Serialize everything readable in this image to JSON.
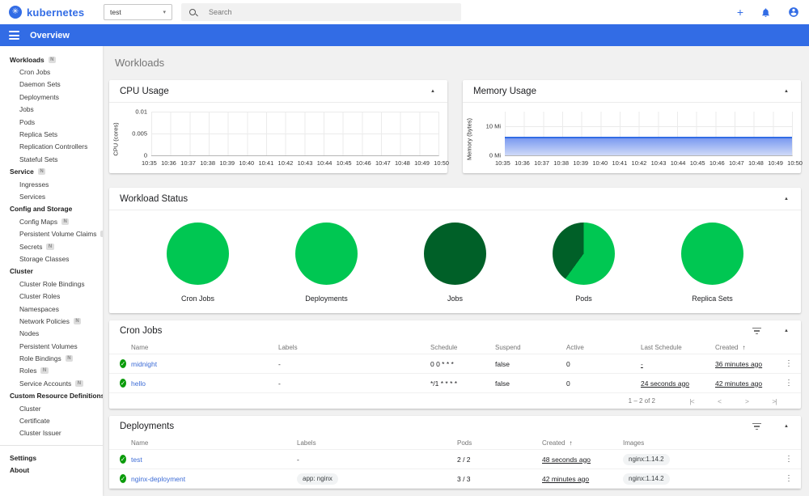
{
  "colors": {
    "brand_blue": "#326ce5",
    "success_green": "#00c752",
    "dark_green": "#006028",
    "check_green": "#0a9b0a",
    "link_blue": "#3d6cd6"
  },
  "icons": {
    "logo_glyph": "✳",
    "dropdown_caret": "▾",
    "plus": "+",
    "collapse_caret": "▲",
    "kebab": "⋮",
    "check": "✓",
    "sort_asc": "↑",
    "pager_first": "|<",
    "pager_prev": "<",
    "pager_next": ">",
    "pager_last": ">|"
  },
  "header": {
    "logo_text": "kubernetes",
    "namespace_selector": {
      "value": "test"
    },
    "search": {
      "placeholder": "Search"
    }
  },
  "appbar": {
    "title": "Overview"
  },
  "sidebar": {
    "items": [
      {
        "kind": "header",
        "label": "Workloads",
        "badge": "N"
      },
      {
        "kind": "child",
        "label": "Cron Jobs"
      },
      {
        "kind": "child",
        "label": "Daemon Sets"
      },
      {
        "kind": "child",
        "label": "Deployments"
      },
      {
        "kind": "child",
        "label": "Jobs"
      },
      {
        "kind": "child",
        "label": "Pods"
      },
      {
        "kind": "child",
        "label": "Replica Sets"
      },
      {
        "kind": "child",
        "label": "Replication Controllers"
      },
      {
        "kind": "child",
        "label": "Stateful Sets"
      },
      {
        "kind": "header",
        "label": "Service",
        "badge": "N"
      },
      {
        "kind": "child",
        "label": "Ingresses"
      },
      {
        "kind": "child",
        "label": "Services"
      },
      {
        "kind": "header",
        "label": "Config and Storage"
      },
      {
        "kind": "child",
        "label": "Config Maps",
        "badge": "N"
      },
      {
        "kind": "child",
        "label": "Persistent Volume Claims",
        "badge": "N"
      },
      {
        "kind": "child",
        "label": "Secrets",
        "badge": "N"
      },
      {
        "kind": "child",
        "label": "Storage Classes"
      },
      {
        "kind": "header",
        "label": "Cluster"
      },
      {
        "kind": "child",
        "label": "Cluster Role Bindings"
      },
      {
        "kind": "child",
        "label": "Cluster Roles"
      },
      {
        "kind": "child",
        "label": "Namespaces"
      },
      {
        "kind": "child",
        "label": "Network Policies",
        "badge": "N"
      },
      {
        "kind": "child",
        "label": "Nodes"
      },
      {
        "kind": "child",
        "label": "Persistent Volumes"
      },
      {
        "kind": "child",
        "label": "Role Bindings",
        "badge": "N"
      },
      {
        "kind": "child",
        "label": "Roles",
        "badge": "N"
      },
      {
        "kind": "child",
        "label": "Service Accounts",
        "badge": "N"
      },
      {
        "kind": "header",
        "label": "Custom Resource Definitions"
      },
      {
        "kind": "child",
        "label": "Cluster"
      },
      {
        "kind": "child",
        "label": "Certificate"
      },
      {
        "kind": "child",
        "label": "Cluster Issuer"
      },
      {
        "kind": "divider",
        "label": ""
      },
      {
        "kind": "header",
        "label": "Settings"
      },
      {
        "kind": "header",
        "label": "About"
      }
    ]
  },
  "page": {
    "title": "Workloads"
  },
  "charts": {
    "cpu": {
      "title": "CPU Usage",
      "ylabel": "CPU (cores)",
      "y_ticks": [
        "0.01",
        "0.005",
        "0"
      ],
      "x_ticks": [
        "10:35",
        "10:36",
        "10:37",
        "10:38",
        "10:39",
        "10:40",
        "10:41",
        "10:42",
        "10:43",
        "10:44",
        "10:45",
        "10:46",
        "10:47",
        "10:48",
        "10:49",
        "10:50"
      ]
    },
    "memory": {
      "title": "Memory Usage",
      "ylabel": "Memory (bytes)",
      "y_ticks": [
        "10 Mi",
        "0 Mi"
      ],
      "x_ticks": [
        "10:35",
        "10:36",
        "10:37",
        "10:38",
        "10:39",
        "10:40",
        "10:41",
        "10:42",
        "10:43",
        "10:44",
        "10:45",
        "10:46",
        "10:47",
        "10:48",
        "10:49",
        "10:50"
      ]
    }
  },
  "chart_data": [
    {
      "type": "area",
      "title": "CPU Usage",
      "xlabel": "",
      "ylabel": "CPU (cores)",
      "x": [
        "10:35",
        "10:50"
      ],
      "ylim": [
        0,
        0.01
      ],
      "series": []
    },
    {
      "type": "area",
      "title": "Memory Usage",
      "xlabel": "",
      "ylabel": "Memory (bytes)",
      "x": [
        "10:35",
        "10:50"
      ],
      "ylim_mi": [
        0,
        10
      ],
      "series": [
        {
          "name": "memory",
          "values_mi": "flat ≈ 6.5 Mi from 10:35 to 10:50"
        }
      ]
    },
    {
      "type": "pie",
      "title": "Workload Status",
      "pies": [
        {
          "label": "Cron Jobs",
          "slices": [
            {
              "name": "running",
              "fraction": 1
            }
          ]
        },
        {
          "label": "Deployments",
          "slices": [
            {
              "name": "running",
              "fraction": 1
            }
          ]
        },
        {
          "label": "Jobs",
          "slices": [
            {
              "name": "succeeded",
              "fraction": 1
            }
          ]
        },
        {
          "label": "Pods",
          "slices": [
            {
              "name": "running",
              "fraction": 0.6
            },
            {
              "name": "succeeded",
              "fraction": 0.4
            }
          ]
        },
        {
          "label": "Replica Sets",
          "slices": [
            {
              "name": "running",
              "fraction": 1
            }
          ]
        }
      ]
    }
  ],
  "workload_status": {
    "title": "Workload Status",
    "pies": [
      {
        "label": "Cron Jobs",
        "slices": [
          {
            "color": "#00c752",
            "fraction": 1
          }
        ]
      },
      {
        "label": "Deployments",
        "slices": [
          {
            "color": "#00c752",
            "fraction": 1
          }
        ]
      },
      {
        "label": "Jobs",
        "slices": [
          {
            "color": "#006028",
            "fraction": 1
          }
        ]
      },
      {
        "label": "Pods",
        "slices": [
          {
            "color": "#00c752",
            "fraction": 0.6
          },
          {
            "color": "#006028",
            "fraction": 0.4
          }
        ]
      },
      {
        "label": "Replica Sets",
        "slices": [
          {
            "color": "#00c752",
            "fraction": 1
          }
        ]
      }
    ]
  },
  "cron_jobs": {
    "title": "Cron Jobs",
    "columns": {
      "name": "Name",
      "labels": "Labels",
      "schedule": "Schedule",
      "suspend": "Suspend",
      "active": "Active",
      "last_schedule": "Last Schedule",
      "created": "Created"
    },
    "rows": [
      {
        "name": "midnight",
        "labels": "-",
        "schedule": "0 0 * * *",
        "suspend": "false",
        "active": "0",
        "last_schedule": "-",
        "created": "36 minutes ago"
      },
      {
        "name": "hello",
        "labels": "-",
        "schedule": "*/1 * * * *",
        "suspend": "false",
        "active": "0",
        "last_schedule": "24 seconds ago",
        "created": "42 minutes ago"
      }
    ],
    "pagination": {
      "range": "1 – 2 of 2"
    }
  },
  "deployments": {
    "title": "Deployments",
    "columns": {
      "name": "Name",
      "labels": "Labels",
      "pods": "Pods",
      "created": "Created",
      "images": "Images"
    },
    "rows": [
      {
        "name": "test",
        "labels_text": "-",
        "labels_chip": "",
        "pods": "2 / 2",
        "created": "48 seconds ago",
        "image": "nginx:1.14.2"
      },
      {
        "name": "nginx-deployment",
        "labels_text": "",
        "labels_chip": "app: nginx",
        "pods": "3 / 3",
        "created": "42 minutes ago",
        "image": "nginx:1.14.2"
      }
    ]
  }
}
